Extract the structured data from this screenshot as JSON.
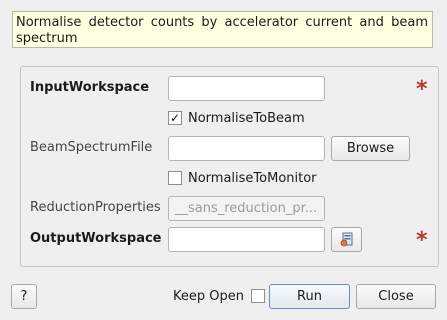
{
  "description": "Normalise detector counts by accelerator current and beam spectrum",
  "form": {
    "input_workspace": {
      "label": "InputWorkspace",
      "value": ""
    },
    "normalise_to_beam": {
      "label": "NormaliseToBeam",
      "checked": true,
      "check_glyph": "✓"
    },
    "beam_spectrum_file": {
      "label": "BeamSpectrumFile",
      "value": "",
      "browse_label": "Browse"
    },
    "normalise_to_monitor": {
      "label": "NormaliseToMonitor",
      "checked": false
    },
    "reduction_properties": {
      "label": "ReductionProperties",
      "value": "__sans_reduction_pr..."
    },
    "output_workspace": {
      "label": "OutputWorkspace",
      "value": "",
      "icon": "workspace-picker-icon"
    },
    "required_marker": "*"
  },
  "footer": {
    "help_label": "?",
    "keep_open_label": "Keep Open",
    "keep_open_checked": false,
    "run_label": "Run",
    "close_label": "Close"
  },
  "colors": {
    "description_bg": "#ffffe1",
    "required_star": "#b6382a",
    "run_border": "#6a8fbd"
  }
}
